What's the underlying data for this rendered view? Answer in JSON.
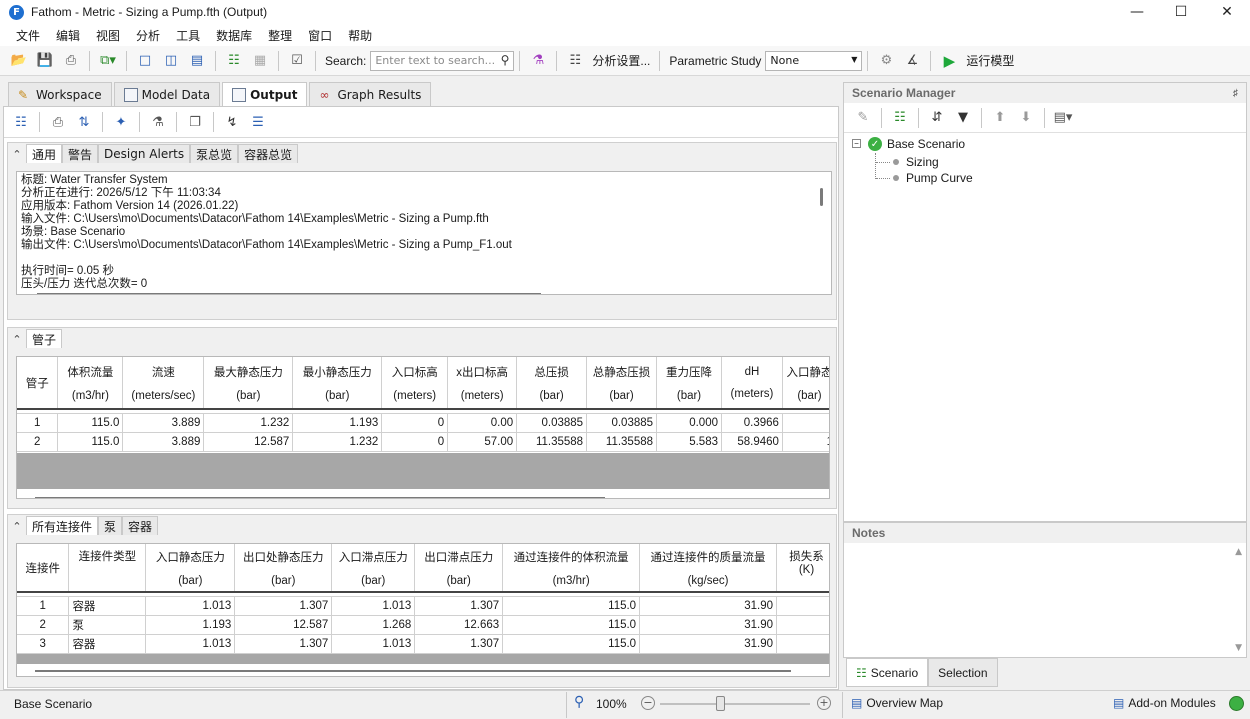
{
  "window": {
    "title": "Fathom - Metric - Sizing a Pump.fth (Output)",
    "app_icon": "F",
    "controls": [
      "minimize-icon",
      "maximize-icon",
      "close-icon"
    ]
  },
  "menu": [
    "文件",
    "编辑",
    "视图",
    "分析",
    "工具",
    "数据库",
    "整理",
    "窗口",
    "帮助"
  ],
  "toolbar": {
    "search_label": "Search:",
    "search_placeholder": "Enter text to search...",
    "analysis_settings": "分析设置...",
    "parametric_label": "Parametric Study",
    "parametric_value": "None",
    "run_label": "运行模型"
  },
  "main_tabs": [
    {
      "label": "Workspace",
      "icon": "pencil-icon"
    },
    {
      "label": "Model Data",
      "icon": "table-icon"
    },
    {
      "label": "Output",
      "icon": "grid-icon"
    },
    {
      "label": "Graph Results",
      "icon": "chart-icon"
    }
  ],
  "general_section": {
    "tabs": [
      "通用",
      "警告",
      "Design Alerts",
      "泵总览",
      "容器总览"
    ],
    "lines": [
      "标题: Water Transfer System",
      "分析正在进行: 2026/5/12 下午 11:03:34",
      "应用版本: Fathom Version 14 (2026.01.22)",
      "输入文件: C:\\Users\\mo\\Documents\\Datacor\\Fathom 14\\Examples\\Metric - Sizing a Pump.fth",
      "场景: Base Scenario",
      "输出文件: C:\\Users\\mo\\Documents\\Datacor\\Fathom 14\\Examples\\Metric - Sizing a Pump_F1.out",
      "",
      "执行时间= 0.05 秒",
      "压头/压力 迭代总次数= 0"
    ]
  },
  "pipes_section": {
    "tab": "管子",
    "row_header": "管子",
    "headers": [
      {
        "name": "体积流量",
        "unit": "(m3/hr)"
      },
      {
        "name": "流速",
        "unit": "(meters/sec)"
      },
      {
        "name": "最大静态压力",
        "unit": "(bar)"
      },
      {
        "name": "最小静态压力",
        "unit": "(bar)"
      },
      {
        "name": "入口标高",
        "unit": "(meters)"
      },
      {
        "name": "x出口标高",
        "unit": "(meters)"
      },
      {
        "name": "总压损",
        "unit": "(bar)"
      },
      {
        "name": "总静态压损",
        "unit": "(bar)"
      },
      {
        "name": "重力压降",
        "unit": "(bar)"
      },
      {
        "name": "dH",
        "unit": "(meters)"
      },
      {
        "name": "入口静态",
        "unit": "(bar)"
      }
    ],
    "rows": [
      {
        "id": "1",
        "cells": [
          "115.0",
          "3.889",
          "1.232",
          "1.193",
          "0",
          "0.00",
          "0.03885",
          "0.03885",
          "0.000",
          "0.3966",
          ""
        ]
      },
      {
        "id": "2",
        "cells": [
          "115.0",
          "3.889",
          "12.587",
          "1.232",
          "0",
          "57.00",
          "11.35588",
          "11.35588",
          "5.583",
          "58.9460",
          "1"
        ]
      }
    ]
  },
  "junctions_section": {
    "tabs": [
      "所有连接件",
      "泵",
      "容器"
    ],
    "row_header": "连接件",
    "headers": [
      {
        "name": "连接件类型",
        "unit": ""
      },
      {
        "name": "入口静态压力",
        "unit": "(bar)"
      },
      {
        "name": "出口处静态压力",
        "unit": "(bar)"
      },
      {
        "name": "入口滞点压力",
        "unit": "(bar)"
      },
      {
        "name": "出口滞点压力",
        "unit": "(bar)"
      },
      {
        "name": "通过连接件的体积流量",
        "unit": "(m3/hr)"
      },
      {
        "name": "通过连接件的质量流量",
        "unit": "(kg/sec)"
      },
      {
        "name": "损失系",
        "unit": "(K)"
      }
    ],
    "rows": [
      {
        "id": "1",
        "cells": [
          "容器",
          "1.013",
          "1.307",
          "1.013",
          "1.307",
          "115.0",
          "31.90",
          ""
        ]
      },
      {
        "id": "2",
        "cells": [
          "泵",
          "1.193",
          "12.587",
          "1.268",
          "12.663",
          "115.0",
          "31.90",
          ""
        ]
      },
      {
        "id": "3",
        "cells": [
          "容器",
          "1.013",
          "1.307",
          "1.013",
          "1.307",
          "115.0",
          "31.90",
          ""
        ]
      }
    ]
  },
  "scenario_manager": {
    "title": "Scenario Manager",
    "base": "Base Scenario",
    "children": [
      "Sizing",
      "Pump Curve"
    ]
  },
  "notes": {
    "title": "Notes"
  },
  "right_tabs": [
    "Scenario",
    "Selection"
  ],
  "status": {
    "scenario": "Base Scenario",
    "zoom": "100%",
    "zoom_level": 0.4,
    "overview": "Overview Map",
    "addons": "Add-on Modules"
  },
  "colors": {
    "accent": "#1e6fd0",
    "run_green": "#1ea83a",
    "status_ok": "#3cb043"
  }
}
